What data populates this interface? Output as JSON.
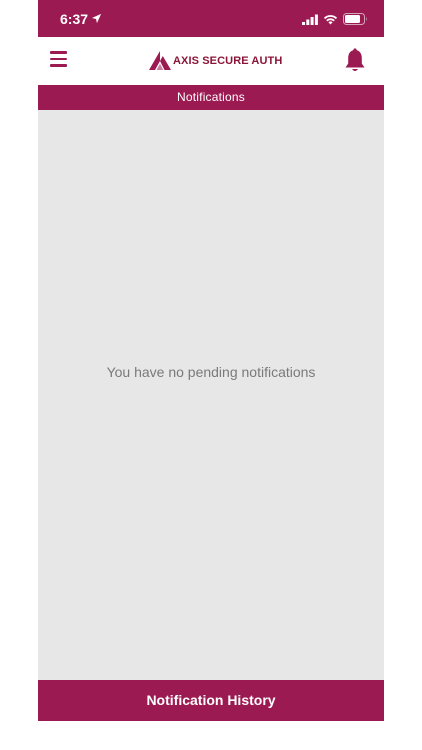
{
  "status_bar": {
    "time": "6:37",
    "icons": [
      "location-arrow-icon",
      "cellular-signal-icon",
      "wifi-icon",
      "battery-icon"
    ]
  },
  "app_bar": {
    "menu_icon": "hamburger-menu-icon",
    "brand_name": "AXIS SECURE AUTH",
    "notification_icon": "bell-icon"
  },
  "section_header": {
    "title": "Notifications"
  },
  "content": {
    "empty_message": "You have no pending notifications"
  },
  "footer": {
    "history_label": "Notification History"
  },
  "colors": {
    "brand": "#9c1a52",
    "brand_text": "#8b1538",
    "content_background": "#e7e7e7",
    "empty_text": "#7a7a7a"
  }
}
